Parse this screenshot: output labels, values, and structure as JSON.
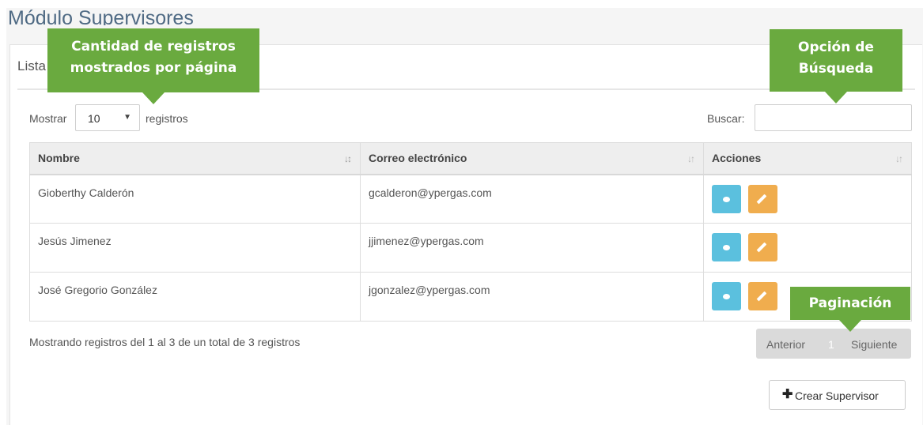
{
  "header": {
    "title": "Módulo Supervisores"
  },
  "panel": {
    "heading": "Lista de Supervisores"
  },
  "length_menu": {
    "prefix": "Mostrar",
    "selected": "10",
    "suffix": "registros"
  },
  "search": {
    "label": "Buscar:",
    "value": "",
    "placeholder": ""
  },
  "table": {
    "columns": [
      "Nombre",
      "Correo electrónico",
      "Acciones"
    ],
    "rows": [
      {
        "name": "Gioberthy Calderón",
        "email": "gcalderon@ypergas.com"
      },
      {
        "name": "Jesús Jimenez",
        "email": "jjimenez@ypergas.com"
      },
      {
        "name": "José Gregorio González",
        "email": "jgonzalez@ypergas.com"
      }
    ],
    "action_icons": [
      "eye-icon",
      "pencil-icon"
    ]
  },
  "info": "Mostrando registros del 1 al 3 de un total de 3 registros",
  "pagination": {
    "previous": "Anterior",
    "current_page": "1",
    "next": "Siguiente"
  },
  "create_button": {
    "label": "Crear Supervisor",
    "icon": "plus-icon"
  },
  "callouts": {
    "cantidad": [
      "Cantidad de registros",
      "mostrados por página"
    ],
    "busqueda": [
      "Opción de",
      "Búsqueda"
    ],
    "paginacion": "Paginación"
  },
  "colors": {
    "accent_callout": "#6aaa3f",
    "view_button": "#5bc0de",
    "edit_button": "#f0ad4e",
    "title": "#4f6a84"
  }
}
